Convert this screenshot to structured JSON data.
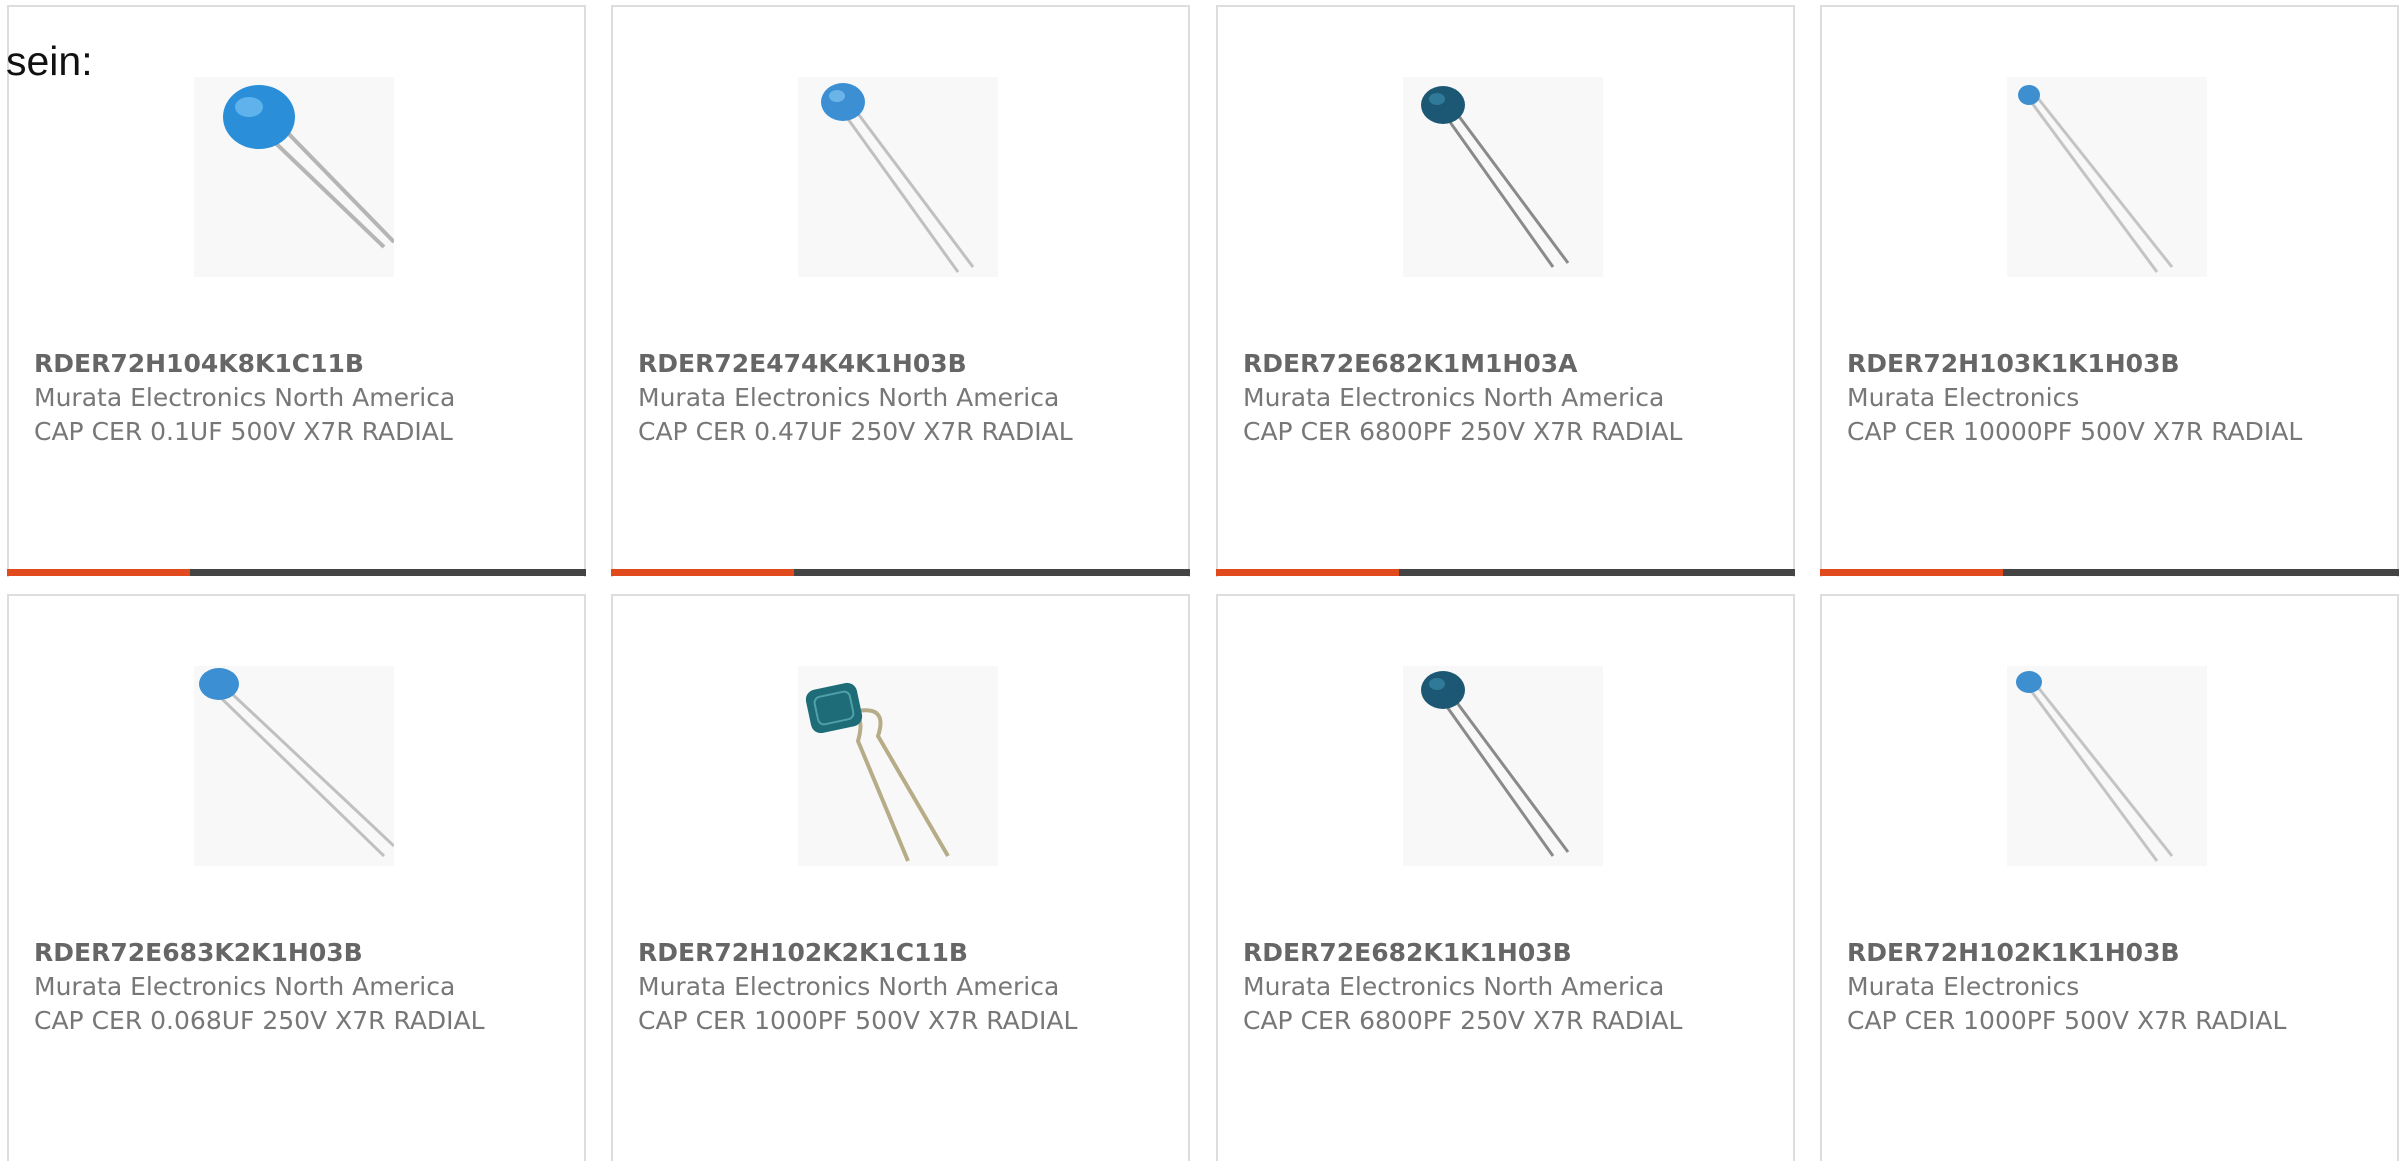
{
  "prefix_text": "sein:",
  "colors": {
    "accent_bar": "#e04a1d",
    "base_bar": "#444444",
    "card_border": "#dddddd",
    "text_gray": "#777777"
  },
  "products": [
    {
      "part_number": "RDER72H104K8K1C11B",
      "manufacturer": "Murata Electronics North America",
      "description": "CAP CER 0.1UF 500V X7R RADIAL",
      "image_icon": "radial-capacitor-icon"
    },
    {
      "part_number": "RDER72E474K4K1H03B",
      "manufacturer": "Murata Electronics North America",
      "description": "CAP CER 0.47UF 250V X7R RADIAL",
      "image_icon": "radial-capacitor-icon"
    },
    {
      "part_number": "RDER72E682K1M1H03A",
      "manufacturer": "Murata Electronics North America",
      "description": "CAP CER 6800PF 250V X7R RADIAL",
      "image_icon": "radial-capacitor-icon"
    },
    {
      "part_number": "RDER72H103K1K1H03B",
      "manufacturer": "Murata Electronics",
      "description": "CAP CER 10000PF 500V X7R RADIAL",
      "image_icon": "radial-capacitor-icon"
    },
    {
      "part_number": "RDER72E683K2K1H03B",
      "manufacturer": "Murata Electronics North America",
      "description": "CAP CER 0.068UF 250V X7R RADIAL",
      "image_icon": "radial-capacitor-icon"
    },
    {
      "part_number": "RDER72H102K2K1C11B",
      "manufacturer": "Murata Electronics North America",
      "description": "CAP CER 1000PF 500V X7R RADIAL",
      "image_icon": "radial-capacitor-icon"
    },
    {
      "part_number": "RDER72E682K1K1H03B",
      "manufacturer": "Murata Electronics North America",
      "description": "CAP CER 6800PF 250V X7R RADIAL",
      "image_icon": "radial-capacitor-icon"
    },
    {
      "part_number": "RDER72H102K1K1H03B",
      "manufacturer": "Murata Electronics",
      "description": "CAP CER 1000PF 500V X7R RADIAL",
      "image_icon": "radial-capacitor-icon"
    }
  ]
}
